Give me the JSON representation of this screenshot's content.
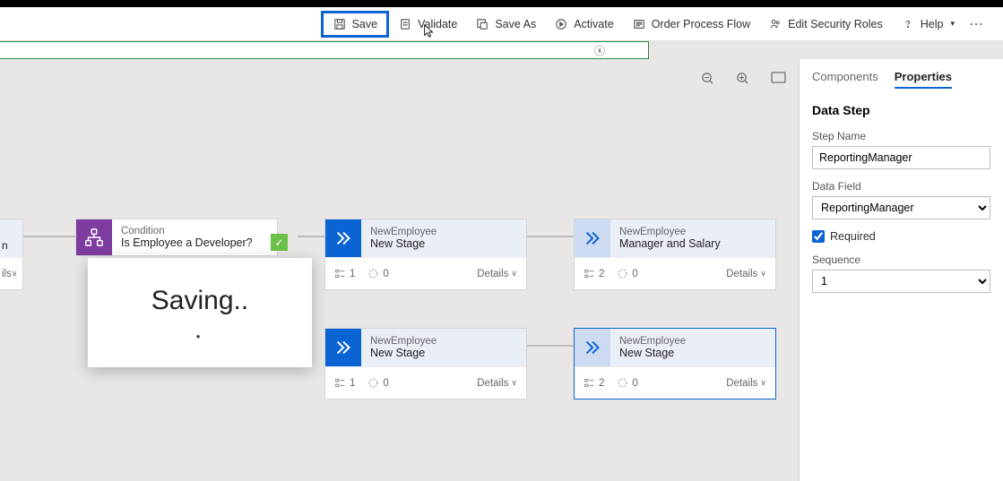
{
  "toolbar": {
    "save": "Save",
    "validate": "Validate",
    "save_as": "Save As",
    "activate": "Activate",
    "order": "Order Process Flow",
    "security": "Edit Security Roles",
    "help": "Help"
  },
  "partial": {
    "title": "n",
    "foot": "ils"
  },
  "condition": {
    "entity": "Condition",
    "question": "Is Employee a Developer?"
  },
  "stages": [
    {
      "entity": "NewEmployee",
      "name": "New Stage",
      "count": "1",
      "zero": "0",
      "details": "Details"
    },
    {
      "entity": "NewEmployee",
      "name": "Manager and Salary",
      "count": "2",
      "zero": "0",
      "details": "Details"
    },
    {
      "entity": "NewEmployee",
      "name": "New Stage",
      "count": "1",
      "zero": "0",
      "details": "Details"
    },
    {
      "entity": "NewEmployee",
      "name": "New Stage",
      "count": "2",
      "zero": "0",
      "details": "Details"
    }
  ],
  "saving": {
    "text": "Saving.."
  },
  "panel": {
    "tab_components": "Components",
    "tab_properties": "Properties",
    "title": "Data Step",
    "step_name_label": "Step Name",
    "step_name_value": "ReportingManager",
    "data_field_label": "Data Field",
    "data_field_value": "ReportingManager",
    "required_label": "Required",
    "sequence_label": "Sequence",
    "sequence_value": "1"
  }
}
